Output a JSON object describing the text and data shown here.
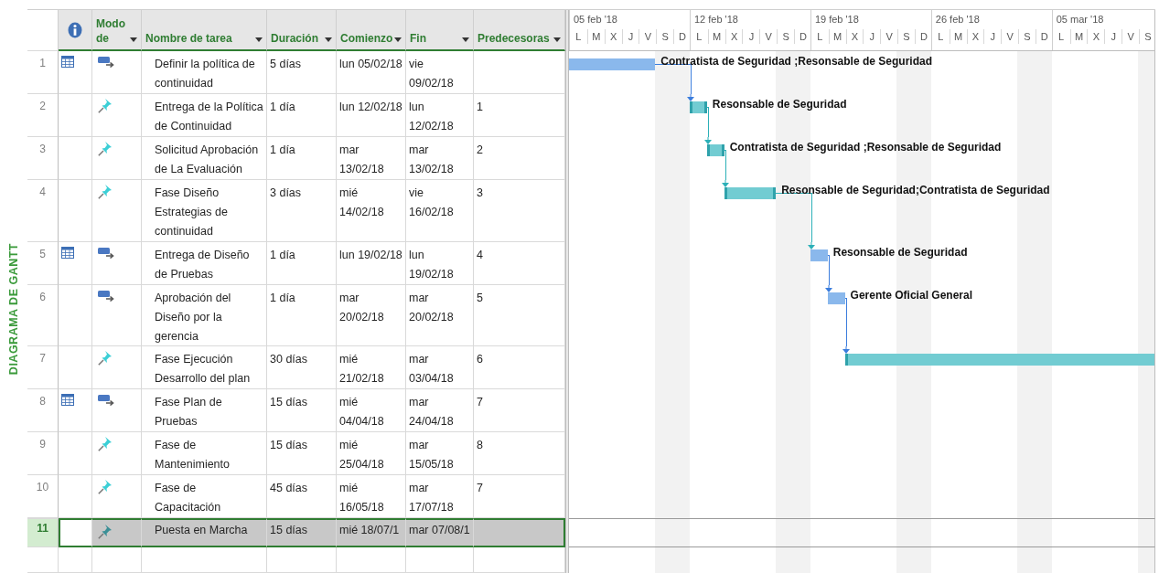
{
  "view_label": "DIAGRAMA DE GANTT",
  "columns": [
    {
      "kind": "info"
    },
    {
      "kind": "text",
      "label": "Modo de"
    },
    {
      "kind": "text",
      "label": "Nombre de tarea"
    },
    {
      "kind": "text",
      "label": "Duración"
    },
    {
      "kind": "text",
      "label": "Comienzo"
    },
    {
      "kind": "text",
      "label": "Fin"
    },
    {
      "kind": "text",
      "label": "Predecesoras"
    }
  ],
  "timescale": {
    "weeks": [
      {
        "label": "05 feb '18",
        "days": [
          "L",
          "M",
          "X",
          "J",
          "V",
          "S",
          "D"
        ]
      },
      {
        "label": "12 feb '18",
        "days": [
          "L",
          "M",
          "X",
          "J",
          "V",
          "S",
          "D"
        ]
      },
      {
        "label": "19 feb '18",
        "days": [
          "L",
          "M",
          "X",
          "J",
          "V",
          "S",
          "D"
        ]
      },
      {
        "label": "26 feb '18",
        "days": [
          "L",
          "M",
          "X",
          "J",
          "V",
          "S",
          "D"
        ]
      },
      {
        "label": "05 mar '18",
        "days": [
          "L",
          "M",
          "X",
          "J",
          "V",
          "S"
        ]
      }
    ]
  },
  "rows": [
    {
      "id": "1",
      "calendar": true,
      "kind": "auto",
      "name": "Definir la política de continuidad",
      "duration": "5 días",
      "start": "lun 05/02/18",
      "finish": "vie 09/02/18",
      "resources": "Contratista de Seguridad ;Resonsable de Seguridad",
      "selected": false
    },
    {
      "id": "2",
      "calendar": false,
      "kind": "manual",
      "name": "Entrega de la Política de Continuidad",
      "duration": "1 día",
      "start": "lun 12/02/18",
      "finish": "lun 12/02/18",
      "predecessors": "1",
      "resources": "Resonsable de Seguridad",
      "selected": false
    },
    {
      "id": "3",
      "calendar": false,
      "kind": "manual",
      "name": "Solicitud Aprobación de La Evaluación",
      "duration": "1 día",
      "start": "mar 13/02/18",
      "finish": "mar 13/02/18",
      "predecessors": "2",
      "resources": "Contratista de Seguridad ;Resonsable de Seguridad",
      "selected": false
    },
    {
      "id": "4",
      "calendar": false,
      "kind": "manual",
      "name": "Fase Diseño Estrategias de continuidad",
      "duration": "3 días",
      "start": "mié 14/02/18",
      "finish": "vie 16/02/18",
      "predecessors": "3",
      "resources": "Resonsable de Seguridad;Contratista de Seguridad",
      "selected": false
    },
    {
      "id": "5",
      "calendar": true,
      "kind": "auto",
      "name": "Entrega de Diseño de Pruebas",
      "duration": "1 día",
      "start": "lun 19/02/18",
      "finish": "lun 19/02/18",
      "predecessors": "4",
      "resources": "Resonsable de Seguridad",
      "selected": false
    },
    {
      "id": "6",
      "calendar": false,
      "kind": "auto",
      "name": "Aprobación del Diseño por la gerencia",
      "duration": "1 día",
      "start": "mar 20/02/18",
      "finish": "mar 20/02/18",
      "predecessors": "5",
      "resources": "Gerente Oficial General",
      "selected": false
    },
    {
      "id": "7",
      "calendar": false,
      "kind": "manual",
      "name": "Fase Ejecución Desarrollo del plan",
      "duration": "30 días",
      "start": "mié 21/02/18",
      "finish": "mar 03/04/18",
      "predecessors": "6",
      "selected": false
    },
    {
      "id": "8",
      "calendar": true,
      "kind": "auto",
      "name": "Fase Plan de Pruebas",
      "duration": "15 días",
      "start": "mié 04/04/18",
      "finish": "mar 24/04/18",
      "predecessors": "7",
      "selected": false
    },
    {
      "id": "9",
      "calendar": false,
      "kind": "manual",
      "name": "Fase de Mantenimiento",
      "duration": "15 días",
      "start": "mié 25/04/18",
      "finish": "mar 15/05/18",
      "predecessors": "8",
      "selected": false
    },
    {
      "id": "10",
      "calendar": false,
      "kind": "manual",
      "name": "Fase de Capacitación",
      "duration": "45 días",
      "start": "mié 16/05/18",
      "finish": "mar 17/07/18",
      "predecessors": "7",
      "selected": false
    },
    {
      "id": "11",
      "calendar": false,
      "kind": "manual",
      "name": "Puesta en Marcha",
      "duration": "15 días",
      "start": "mié 18/07/1",
      "finish": "mar 07/08/1",
      "selected": true
    }
  ]
}
